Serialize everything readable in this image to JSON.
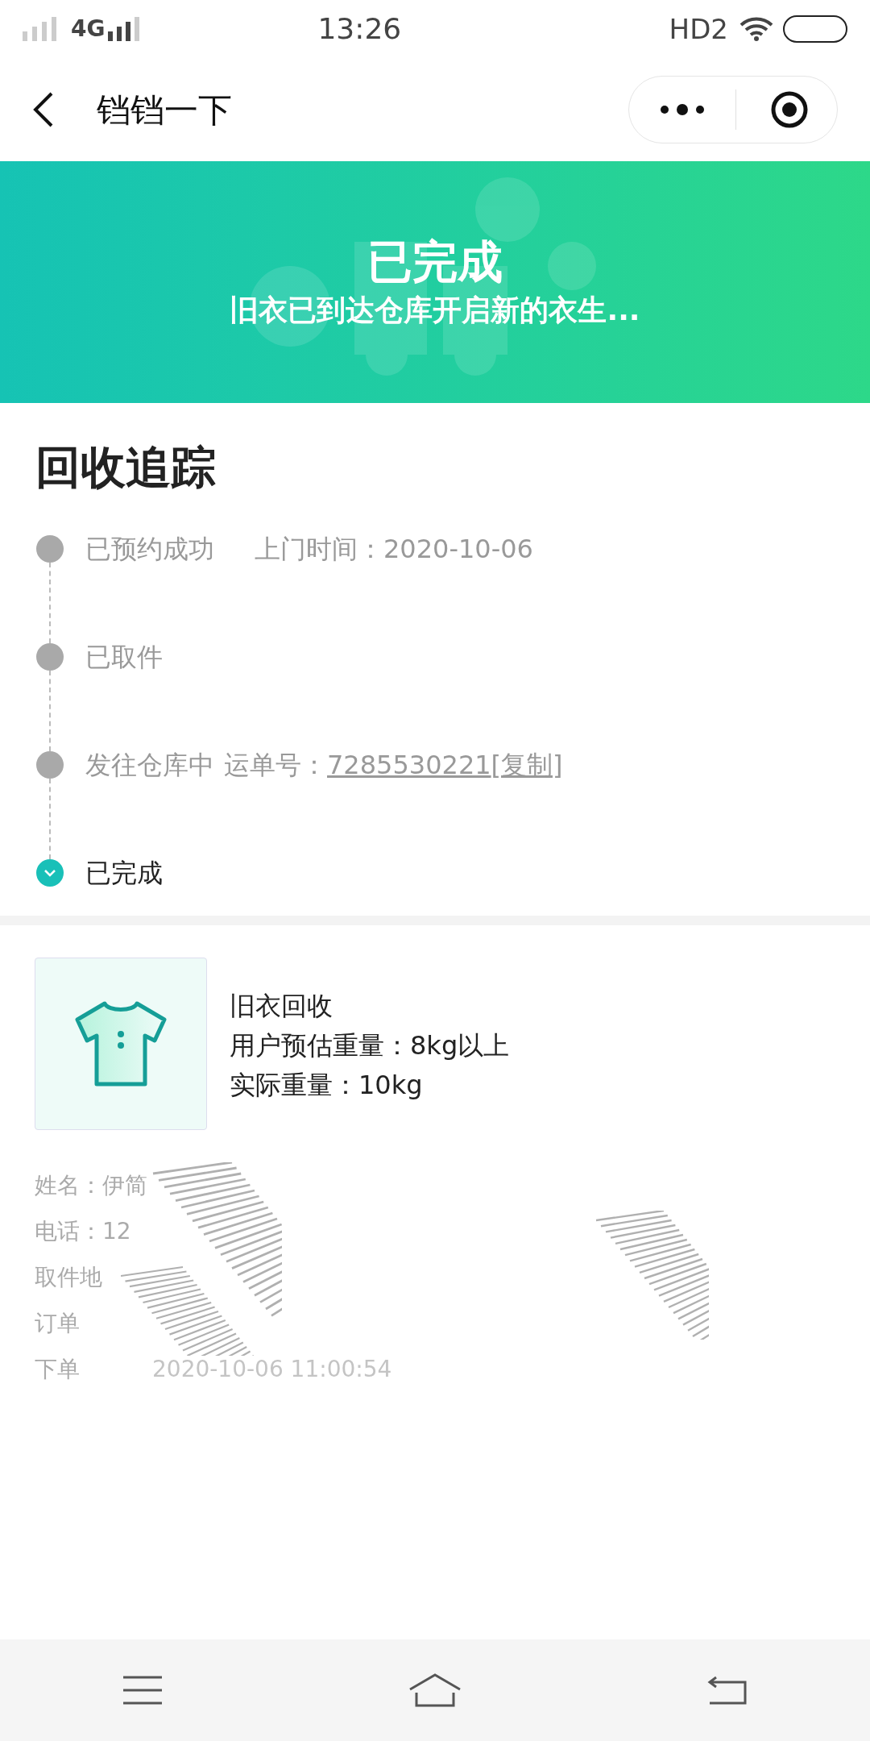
{
  "status_bar": {
    "network": "4G",
    "time": "13:26",
    "hd": "HD2"
  },
  "nav": {
    "title": "铛铛一下"
  },
  "banner": {
    "title": "已完成",
    "subtitle": "旧衣已到达仓库开启新的衣生..."
  },
  "tracking": {
    "title": "回收追踪",
    "steps": [
      {
        "label": "已预约成功",
        "detail": "上门时间：2020-10-06",
        "current": false
      },
      {
        "label": "已取件",
        "current": false
      },
      {
        "label": "发往仓库中",
        "detail": "运单号：",
        "waybill": "7285530221",
        "copy": "[复制]",
        "current": false
      },
      {
        "label": "已完成",
        "current": true
      }
    ]
  },
  "product": {
    "name": "旧衣回收",
    "estimated": "用户预估重量：8kg以上",
    "actual": "实际重量：10kg"
  },
  "info": [
    "姓名：伊简",
    "电话：12",
    "取件地",
    "订单",
    "下单",
    "2020-10-06 11:00:54"
  ]
}
